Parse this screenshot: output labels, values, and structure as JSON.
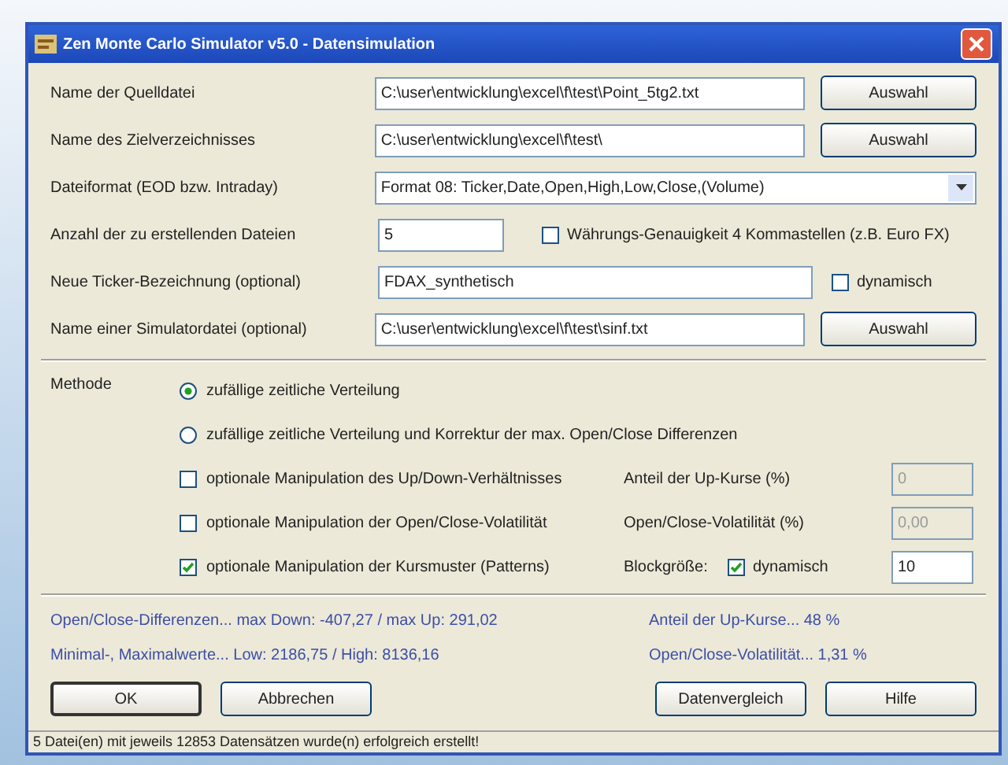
{
  "window": {
    "title": "Zen Monte Carlo Simulator v5.0 - Datensimulation"
  },
  "file_rows": [
    {
      "kind": "browse",
      "label": "Name der Quelldatei",
      "value": "C:\\user\\entwicklung\\excel\\f\\test\\Point_5tg2.txt",
      "button": "Auswahl"
    },
    {
      "kind": "browse",
      "label": "Name des Zielverzeichnisses",
      "value": "C:\\user\\entwicklung\\excel\\f\\test\\",
      "button": "Auswahl"
    },
    {
      "kind": "select",
      "label": "Dateiformat (EOD bzw. Intraday)",
      "value": "Format 08: Ticker,Date,Open,High,Low,Close,(Volume)"
    },
    {
      "kind": "count",
      "label": "Anzahl der zu erstellenden Dateien",
      "value": "5",
      "option": {
        "label": "Währungs-Genauigkeit 4 Kommastellen (z.B. Euro FX)",
        "checked": false
      }
    },
    {
      "kind": "ticker",
      "label": "Neue Ticker-Bezeichnung (optional)",
      "value": "FDAX_synthetisch",
      "option": {
        "label": "dynamisch",
        "checked": false
      }
    },
    {
      "kind": "browse",
      "label": "Name einer Simulatordatei (optional)",
      "value": "C:\\user\\entwicklung\\excel\\f\\test\\sinf.txt",
      "button": "Auswahl"
    }
  ],
  "method": {
    "label": "Methode",
    "options": [
      {
        "kind": "radio",
        "label": "zufällige zeitliche Verteilung",
        "selected": true
      },
      {
        "kind": "radio",
        "label": "zufällige zeitliche Verteilung und Korrektur der max. Open/Close Differenzen",
        "selected": false
      },
      {
        "kind": "check",
        "label": "optionale Manipulation des Up/Down-Verhältnisses",
        "checked": false,
        "param": {
          "label": "Anteil der Up-Kurse (%)",
          "value": "0",
          "disabled": true
        }
      },
      {
        "kind": "check",
        "label": "optionale Manipulation der Open/Close-Volatilität",
        "checked": false,
        "param": {
          "label": "Open/Close-Volatilität (%)",
          "value": "0,00",
          "disabled": true
        }
      },
      {
        "kind": "check",
        "label": "optionale Manipulation der Kursmuster (Patterns)",
        "checked": true,
        "param": {
          "label": "Blockgröße:",
          "value": "10",
          "disabled": false,
          "option": {
            "label": "dynamisch",
            "checked": true
          }
        }
      }
    ]
  },
  "stats_left": [
    "Open/Close-Differenzen... max Down: -407,27  /  max Up: 291,02",
    "Minimal-, Maximalwerte... Low: 2186,75  /  High: 8136,16"
  ],
  "stats_right": [
    "Anteil der Up-Kurse... 48 %",
    "Open/Close-Volatilität... 1,31 %"
  ],
  "buttons_left": [
    {
      "label": "OK",
      "default": true
    },
    {
      "label": "Abbrechen",
      "default": false
    }
  ],
  "buttons_right": [
    {
      "label": "Datenvergleich",
      "default": false
    },
    {
      "label": "Hilfe",
      "default": false
    }
  ],
  "status_bar": "5 Datei(en) mit jeweils 12853 Datensätzen wurde(n) erfolgreich erstellt!"
}
